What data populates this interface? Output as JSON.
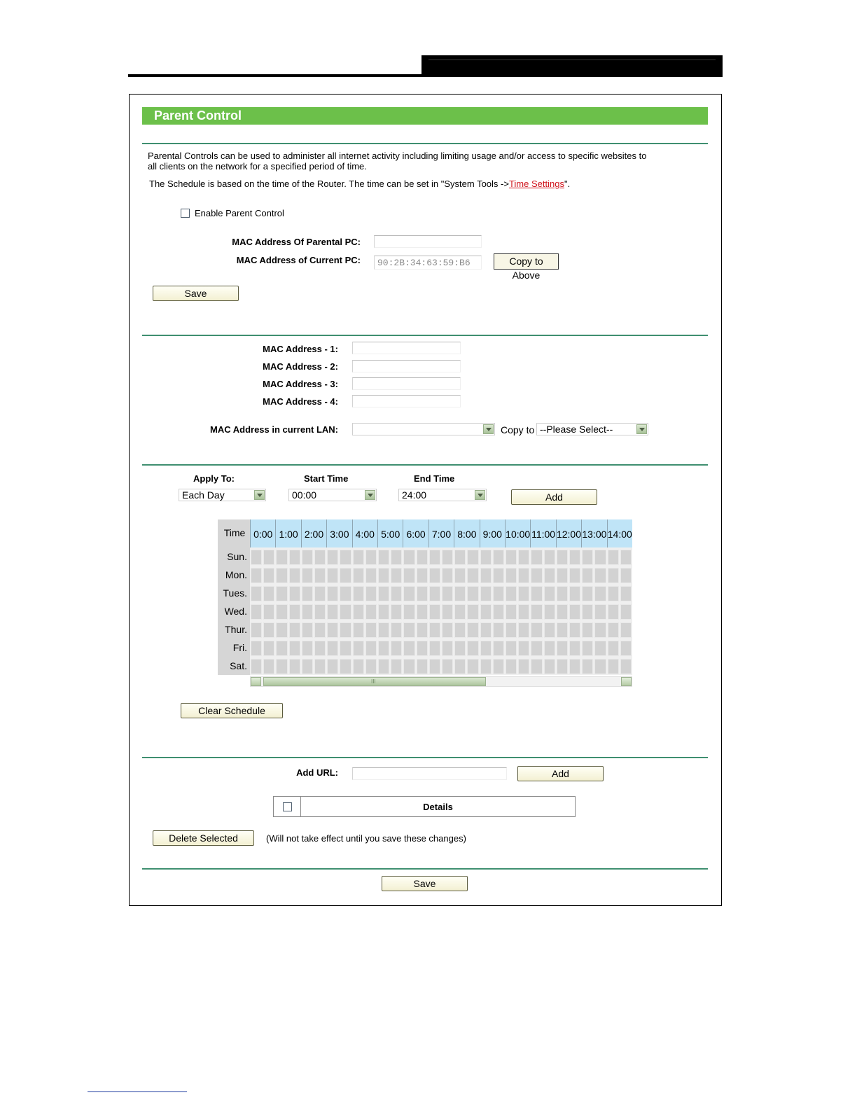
{
  "header": {
    "title": "Parent Control"
  },
  "intro": {
    "line1": "Parental Controls can be used to administer all internet activity including limiting usage and/or access to specific websites to",
    "line2": "all clients on the network for a specified period of time.",
    "schedule_prefix": "The Schedule is based on the time of the Router. The time can be set in \"System Tools ->",
    "schedule_link": "Time Settings",
    "schedule_suffix": "\"."
  },
  "enable": {
    "label": "Enable Parent Control",
    "checked": false
  },
  "parental_pc": {
    "mac_parental_label": "MAC Address Of Parental PC:",
    "mac_parental_value": "",
    "mac_current_label": "MAC Address of Current PC:",
    "mac_current_value": "90:2B:34:63:59:B6",
    "copy_button": "Copy to Above",
    "save_button": "Save"
  },
  "children": {
    "mac1_label": "MAC Address - 1:",
    "mac2_label": "MAC Address - 2:",
    "mac3_label": "MAC Address - 3:",
    "mac4_label": "MAC Address - 4:",
    "lan_label": "MAC Address in current LAN:",
    "lan_value": "",
    "copy_to_label": "Copy to",
    "copy_to_value": "--Please Select--"
  },
  "schedule": {
    "apply_label": "Apply To:",
    "apply_value": "Each Day",
    "start_label": "Start Time",
    "start_value": "00:00",
    "end_label": "End Time",
    "end_value": "24:00",
    "add_button": "Add",
    "time_header": "Time",
    "hours": [
      "0:00",
      "1:00",
      "2:00",
      "3:00",
      "4:00",
      "5:00",
      "6:00",
      "7:00",
      "8:00",
      "9:00",
      "10:00",
      "11:00",
      "12:00",
      "13:00",
      "14:00"
    ],
    "days": [
      "Sun.",
      "Mon.",
      "Tues.",
      "Wed.",
      "Thur.",
      "Fri.",
      "Sat."
    ],
    "scroll_grip": "III",
    "clear_button": "Clear Schedule"
  },
  "url": {
    "add_label": "Add URL:",
    "add_value": "",
    "add_button": "Add",
    "details_header": "Details",
    "delete_button": "Delete Selected",
    "note": "(Will not take effect until you save these changes)"
  },
  "footer": {
    "save_button": "Save"
  }
}
